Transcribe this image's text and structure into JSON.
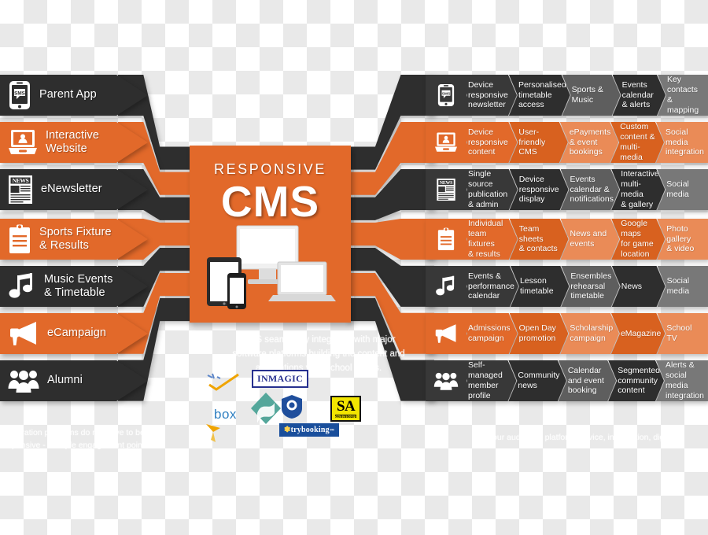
{
  "center": {
    "supertitle": "RESPONSIVE",
    "title": "CMS",
    "icon": "responsive-devices-icon",
    "accent": "#e2692a"
  },
  "colors": {
    "dark": "#383838",
    "dark_alt": "#2e2e2e",
    "gray_mid": "#5e5e5e",
    "gray_light": "#787878",
    "orange": "#e2692a",
    "orange_dark": "#d8611f",
    "orange_light": "#ea8b57",
    "orange_lighter": "#ef9f72",
    "white": "#ffffff"
  },
  "channels": [
    {
      "label": "Parent App",
      "icon": "mobile-sms-icon",
      "theme": "dark",
      "features": [
        "Device\nresponsive\nnewsletter",
        "Personalised\ntimetable\naccess",
        "Sports &\nMusic",
        "Events\ncalendar\n& alerts",
        "Key contacts\n& mapping"
      ]
    },
    {
      "label": "Interactive\nWebsite",
      "icon": "laptop-user-icon",
      "theme": "orange",
      "features": [
        "Device\nresponsive\ncontent",
        "User-friendly\nCMS",
        "ePayments\n& event\nbookings",
        "Custom\ncontent &\nmulti-media",
        "Social media\nintegration"
      ]
    },
    {
      "label": "eNewsletter",
      "icon": "newspaper-icon",
      "theme": "dark",
      "features": [
        "Single source\npublication\n& admin",
        "Device\nresponsive\ndisplay",
        "Events\ncalendar &\nnotifications",
        "Interactive\nmulti-media\n& gallery",
        "Social media"
      ]
    },
    {
      "label": "Sports Fixture\n& Results",
      "icon": "clipboard-icon",
      "theme": "orange",
      "features": [
        "Individual\nteam fixtures\n& results",
        "Team sheets\n& contacts",
        "News and\nevents",
        "Google maps\nfor game\nlocation",
        "Photo gallery\n& video"
      ]
    },
    {
      "label": "Music Events\n& Timetable",
      "icon": "music-note-icon",
      "theme": "dark",
      "features": [
        "Events &\nperformance\ncalendar",
        "Lesson\ntimetable",
        "Ensembles\nrehearsal\ntimetable",
        "News",
        "Social media"
      ]
    },
    {
      "label": "eCampaign",
      "icon": "megaphone-icon",
      "theme": "orange",
      "features": [
        "Admissions\ncampaign",
        "Open Day\npromotion",
        "Scholarship\ncampaign",
        "eMagazine",
        "School TV"
      ]
    },
    {
      "label": "Alumni",
      "icon": "people-group-icon",
      "theme": "dark",
      "features": [
        "Self-managed\nmember\nprofile",
        "Community\nnews",
        "Calendar\nand event\nbooking",
        "Segmented\ncommunity\ncontent",
        "Alerts &\nsocial media\nintegration"
      ]
    }
  ],
  "background_text": {
    "line1": "CMS seamlessly integrates with major",
    "line2": "software platforms building the content and",
    "line3": "applications your school needs.",
    "footer1": "Integration platforms do not have to be",
    "footer2": "expensive - multiple engagement points.",
    "footer3": "Your audience, platform, device, information, digital"
  },
  "logos": [
    {
      "name": "inmagic-logo",
      "text": "INMAGIC"
    },
    {
      "name": "box-logo",
      "text": "box"
    },
    {
      "name": "trybooking-logo",
      "text": "trybooking"
    },
    {
      "name": "sa-logo",
      "text": "SA",
      "sub": "Switchboard"
    },
    {
      "name": "diamond-logo",
      "text": ""
    },
    {
      "name": "badge-logo",
      "text": ""
    }
  ]
}
